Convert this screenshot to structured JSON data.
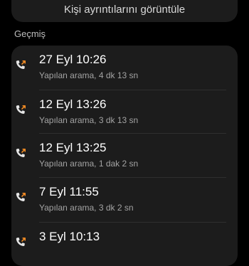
{
  "top_action": {
    "label": "Kişi ayrıntılarını görüntüle"
  },
  "history": {
    "section_label": "Geçmiş",
    "items": [
      {
        "time": "27 Eyl 10:26",
        "detail": "Yapılan arama, 4 dk 13 sn",
        "icon": "outgoing-call-icon"
      },
      {
        "time": "12 Eyl 13:26",
        "detail": "Yapılan arama, 3 dk 13 sn",
        "icon": "outgoing-call-icon"
      },
      {
        "time": "12 Eyl 13:25",
        "detail": "Yapılan arama, 1 dak 2 sn",
        "icon": "outgoing-call-icon"
      },
      {
        "time": "7 Eyl 11:55",
        "detail": "Yapılan arama, 3 dk 2 sn",
        "icon": "outgoing-call-icon"
      },
      {
        "time": "3 Eyl 10:13",
        "detail": "",
        "icon": "outgoing-call-icon"
      }
    ]
  },
  "colors": {
    "background": "#000000",
    "card": "#1c1c1c",
    "phone_icon": "#e6e6e6",
    "outgoing_arrow": "#f08a24"
  }
}
